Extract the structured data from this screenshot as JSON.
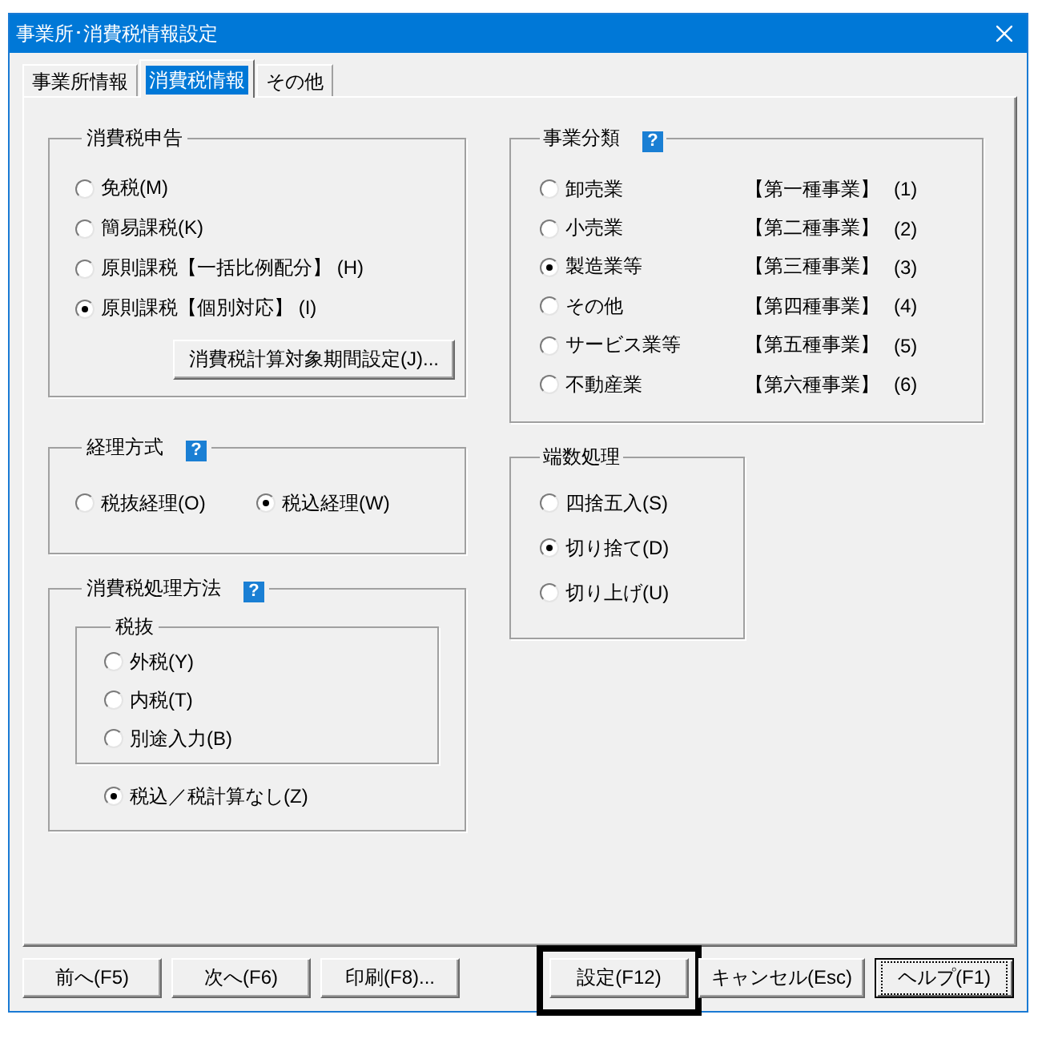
{
  "window": {
    "title": "事業所･消費税情報設定"
  },
  "tabs": [
    {
      "label": "事業所情報",
      "selected": false
    },
    {
      "label": "消費税情報",
      "selected": true
    },
    {
      "label": "その他",
      "selected": false
    }
  ],
  "declaration": {
    "title": "消費税申告",
    "options": [
      {
        "label": "免税(M)",
        "selected": false
      },
      {
        "label": "簡易課税(K)",
        "selected": false
      },
      {
        "label": "原則課税【一括比例配分】 (H)",
        "selected": false
      },
      {
        "label": "原則課税【個別対応】 (I)",
        "selected": true
      }
    ],
    "button": {
      "label": "消費税計算対象期間設定(J)..."
    }
  },
  "accounting": {
    "title": "経理方式",
    "help": "?",
    "options": [
      {
        "label": "税抜経理(O)",
        "selected": false
      },
      {
        "label": "税込経理(W)",
        "selected": true
      }
    ]
  },
  "processing": {
    "title": "消費税処理方法",
    "help": "?",
    "tax_excluded": {
      "title": "税抜",
      "options": [
        {
          "label": "外税(Y)",
          "selected": false
        },
        {
          "label": "内税(T)",
          "selected": false
        },
        {
          "label": "別途入力(B)",
          "selected": false
        }
      ]
    },
    "options": [
      {
        "label": "税込／税計算なし(Z)",
        "selected": true
      }
    ]
  },
  "business_type": {
    "title": "事業分類",
    "help": "?",
    "options": [
      {
        "label": "卸売業",
        "category": "【第一種事業】",
        "shortcut": "(1)",
        "selected": false
      },
      {
        "label": "小売業",
        "category": "【第二種事業】",
        "shortcut": "(2)",
        "selected": false
      },
      {
        "label": "製造業等",
        "category": "【第三種事業】",
        "shortcut": "(3)",
        "selected": true
      },
      {
        "label": "その他",
        "category": "【第四種事業】",
        "shortcut": "(4)",
        "selected": false
      },
      {
        "label": "サービス業等",
        "category": "【第五種事業】",
        "shortcut": "(5)",
        "selected": false
      },
      {
        "label": "不動産業",
        "category": "【第六種事業】",
        "shortcut": "(6)",
        "selected": false
      }
    ]
  },
  "rounding": {
    "title": "端数処理",
    "options": [
      {
        "label": "四捨五入(S)",
        "selected": false
      },
      {
        "label": "切り捨て(D)",
        "selected": true
      },
      {
        "label": "切り上げ(U)",
        "selected": false
      }
    ]
  },
  "footer": {
    "left": [
      {
        "label": "前へ(F5)",
        "focused": false,
        "highlighted": false
      },
      {
        "label": "次へ(F6)",
        "focused": false,
        "highlighted": false
      },
      {
        "label": "印刷(F8)...",
        "focused": false,
        "highlighted": false
      }
    ],
    "right": [
      {
        "label": "設定(F12)",
        "focused": false,
        "highlighted": true
      },
      {
        "label": "キャンセル(Esc)",
        "focused": false,
        "highlighted": false
      },
      {
        "label": "ヘルプ(F1)",
        "focused": true,
        "highlighted": false
      }
    ]
  }
}
